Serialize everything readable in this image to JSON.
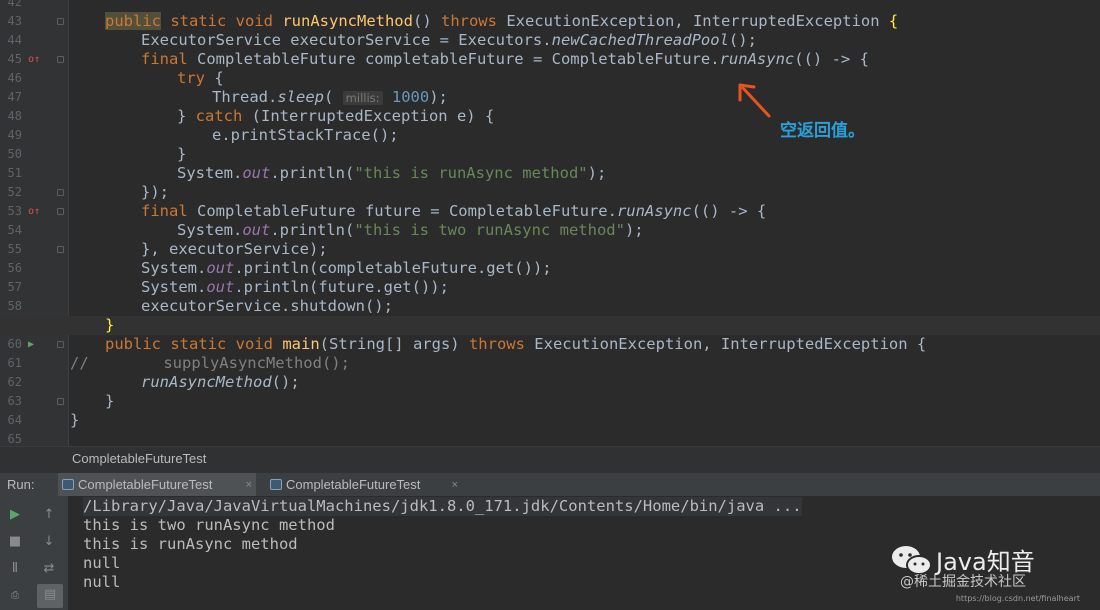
{
  "editor": {
    "lines": [
      {
        "num": "42",
        "mark": "",
        "fold": false
      },
      {
        "num": "43",
        "mark": "",
        "fold": true
      },
      {
        "num": "44",
        "mark": "",
        "fold": false
      },
      {
        "num": "45",
        "mark": "override",
        "fold": true
      },
      {
        "num": "46",
        "mark": "",
        "fold": false
      },
      {
        "num": "47",
        "mark": "",
        "fold": false
      },
      {
        "num": "48",
        "mark": "",
        "fold": false
      },
      {
        "num": "49",
        "mark": "",
        "fold": false
      },
      {
        "num": "50",
        "mark": "",
        "fold": false
      },
      {
        "num": "51",
        "mark": "",
        "fold": false
      },
      {
        "num": "52",
        "mark": "",
        "fold": true
      },
      {
        "num": "53",
        "mark": "override",
        "fold": true
      },
      {
        "num": "54",
        "mark": "",
        "fold": false
      },
      {
        "num": "55",
        "mark": "",
        "fold": true
      },
      {
        "num": "56",
        "mark": "",
        "fold": false
      },
      {
        "num": "57",
        "mark": "",
        "fold": false
      },
      {
        "num": "58",
        "mark": "",
        "fold": false
      },
      {
        "num": "59",
        "mark": "",
        "fold": true
      },
      {
        "num": "60",
        "mark": "run",
        "fold": true
      },
      {
        "num": "61",
        "mark": "",
        "fold": false
      },
      {
        "num": "62",
        "mark": "",
        "fold": false
      },
      {
        "num": "63",
        "mark": "",
        "fold": true
      },
      {
        "num": "64",
        "mark": "",
        "fold": false
      },
      {
        "num": "65",
        "mark": "",
        "fold": false
      }
    ],
    "tokens": {
      "l43_public": "public",
      "l43_static_void": " static void ",
      "l43_method": "runAsyncMethod",
      "l43_parens": "() ",
      "l43_throws": "throws",
      "l43_ex": " ExecutionException, InterruptedException ",
      "l43_brace": "{",
      "l44_a": "ExecutorService executorService = Executors.",
      "l44_b": "newCachedThreadPool",
      "l44_c": "();",
      "l45_final": "final",
      "l45_a": " CompletableFuture completableFuture = CompletableFuture.",
      "l45_b": "runAsync",
      "l45_c": "(() -> {",
      "l46_try": "try",
      "l46_a": " {",
      "l47_a": "Thread.",
      "l47_b": "sleep",
      "l47_c": "( ",
      "l47_hint": "millis:",
      "l47_num": " 1000",
      "l47_d": ");",
      "l48_a": "} ",
      "l48_catch": "catch",
      "l48_b": " (InterruptedException e) {",
      "l49_a": "e.printStackTrace();",
      "l50_a": "}",
      "l51_a": "System.",
      "l51_out": "out",
      "l51_b": ".println(",
      "l51_str": "\"this is runAsync method\"",
      "l51_c": ");",
      "l52_a": "});",
      "l53_final": "final",
      "l53_a": " CompletableFuture future = CompletableFuture.",
      "l53_b": "runAsync",
      "l53_c": "(() -> {",
      "l54_a": "System.",
      "l54_out": "out",
      "l54_b": ".println(",
      "l54_str": "\"this is two runAsync method\"",
      "l54_c": ");",
      "l55_a": "}, executorService);",
      "l56_a": "System.",
      "l56_out": "out",
      "l56_b": ".println(completableFuture.get());",
      "l57_a": "System.",
      "l57_out": "out",
      "l57_b": ".println(future.get());",
      "l58_a": "executorService.shutdown();",
      "l59_a": "}",
      "l60_public": "public",
      "l60_static_void": " static void ",
      "l60_main": "main",
      "l60_a": "(String[] args) ",
      "l60_throws": "throws",
      "l60_b": " ExecutionException, InterruptedException {",
      "l61_a": "//        supplyAsyncMethod();",
      "l62_a": "runAsyncMethod",
      "l62_b": "();",
      "l63_a": "}",
      "l64_a": "}"
    }
  },
  "annotation": {
    "label": "空返回值。",
    "color": "#2a9fd8",
    "arrow_color": "#e8541e"
  },
  "breadcrumb": {
    "text": "CompletableFutureTest"
  },
  "run_panel": {
    "label": "Run:",
    "tabs": [
      {
        "label": "CompletableFutureTest",
        "close": "×",
        "active": true
      },
      {
        "label": "CompletableFutureTest",
        "close": "×",
        "active": false
      }
    ],
    "toolbar_icons": [
      "run-icon",
      "scroll-up-icon",
      "stop-icon",
      "scroll-down-icon",
      "pause-icon",
      "soft-wrap-icon",
      "print-icon"
    ],
    "output": [
      "/Library/Java/JavaVirtualMachines/jdk1.8.0_171.jdk/Contents/Home/bin/java ...",
      "this is two runAsync method",
      "this is runAsync method",
      "null",
      "null"
    ]
  },
  "watermark": {
    "title": "Java知音",
    "subtitle": "@稀土掘金技术社区",
    "url": "https://blog.csdn.net/finalheart"
  },
  "colors": {
    "keyword": "#cc7832",
    "method": "#ffc66d",
    "string": "#6a8759",
    "number": "#6897bb",
    "static_field": "#9876aa",
    "background": "#2b2b2b"
  }
}
